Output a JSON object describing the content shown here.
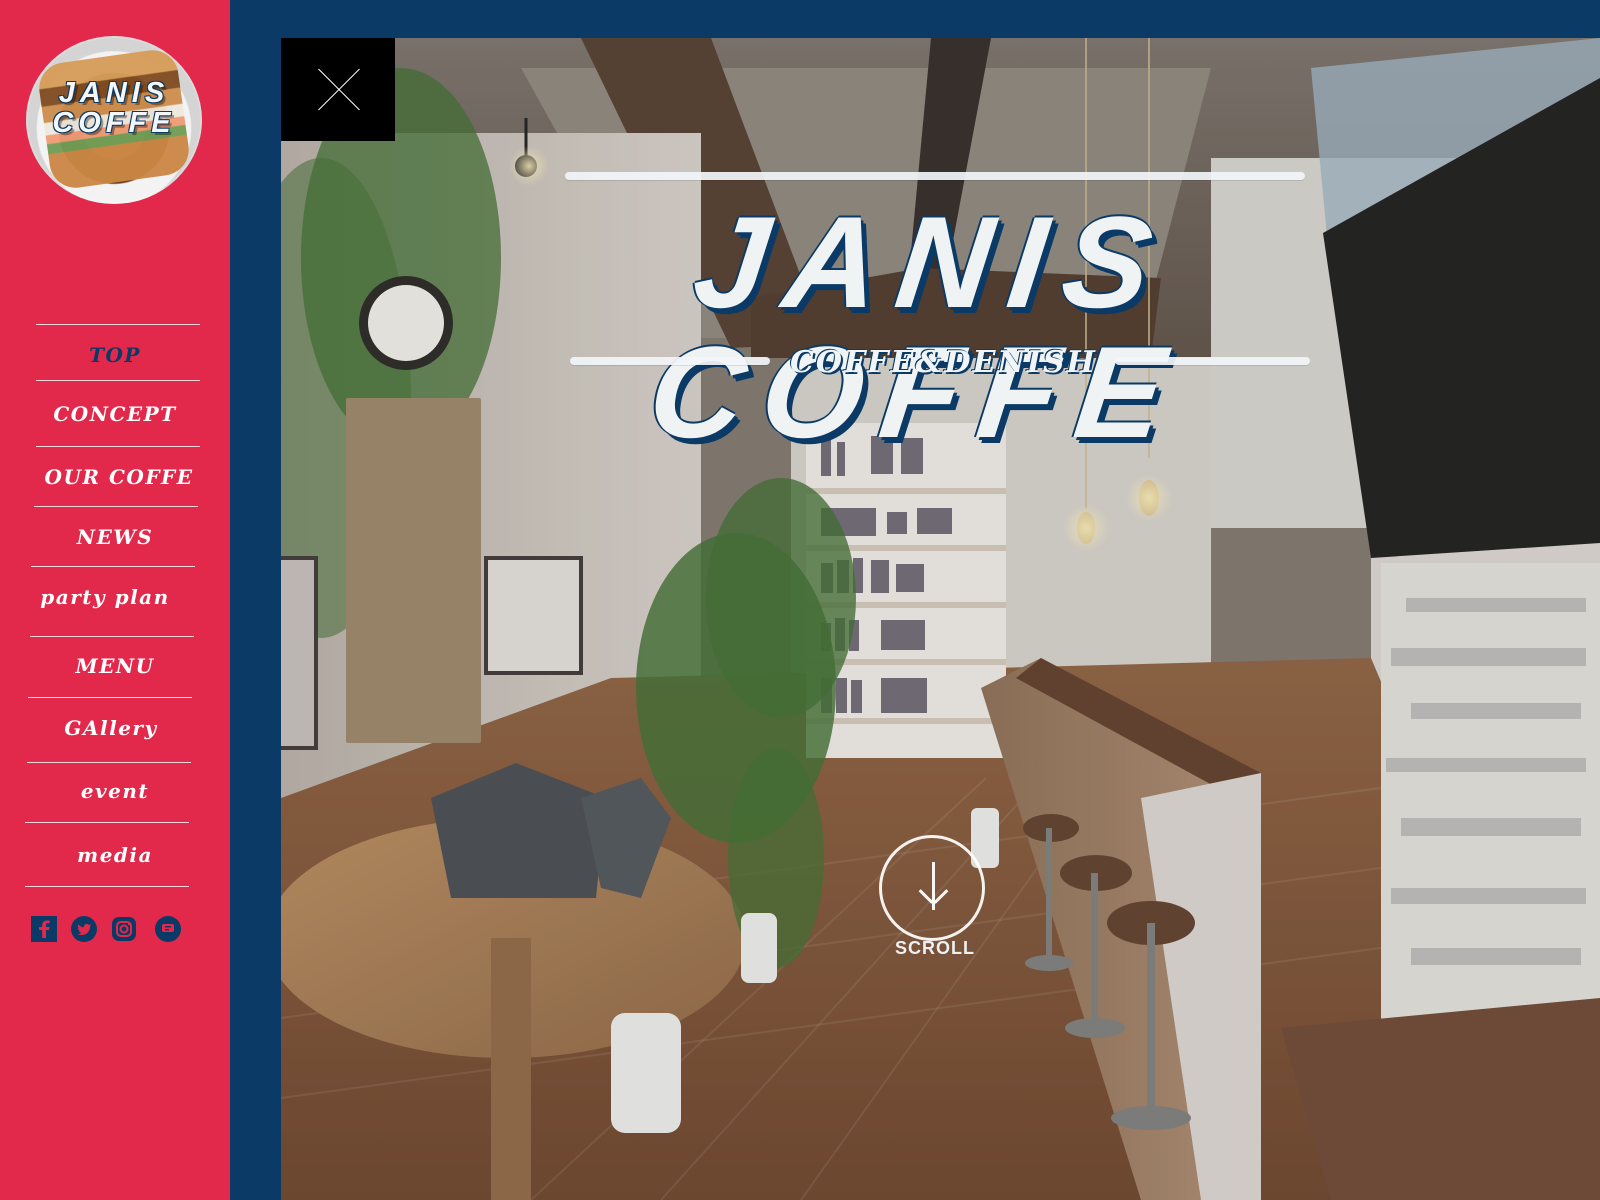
{
  "logo": {
    "line1": "JANIS",
    "line2": "COFFE"
  },
  "sidebar": {
    "items": [
      {
        "label": "TOP",
        "active": true
      },
      {
        "label": "CONCEPT",
        "active": false
      },
      {
        "label": "OUR COFFE",
        "active": false
      },
      {
        "label": "NEWS",
        "active": false
      },
      {
        "label": "party plan",
        "active": false
      },
      {
        "label": "MENU",
        "active": false
      },
      {
        "label": "GAllery",
        "active": false
      },
      {
        "label": "event",
        "active": false
      },
      {
        "label": "media",
        "active": false
      }
    ],
    "social": [
      {
        "name": "facebook-icon"
      },
      {
        "name": "twitter-icon"
      },
      {
        "name": "instagram-icon"
      },
      {
        "name": "line-icon"
      }
    ]
  },
  "hero": {
    "title": "JANIS COFFE",
    "subtitle": "COFFE&DENISH",
    "scroll_label": "SCROLL"
  },
  "colors": {
    "sidebar": "#e3294b",
    "frame": "#0b3a66",
    "ink": "#0b3a66",
    "white": "#ffffff"
  }
}
